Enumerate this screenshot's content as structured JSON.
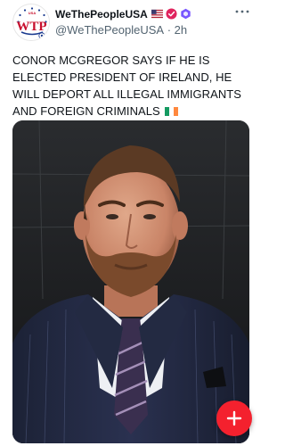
{
  "post": {
    "author": {
      "display_name": "WeThePeopleUSA",
      "handle": "@WeThePeopleUSA",
      "time": "2h",
      "avatar_text": "WTP",
      "avatar_subtext": "USA"
    },
    "text": "CONOR MCGREGOR SAYS IF HE IS ELECTED PRESIDENT OF IRELAND, HE WILL DEPORT ALL ILLEGAL IMMIGRANTS AND FOREIGN CRIMINALS",
    "text_flag": "ireland-flag",
    "badges": [
      "usa-flag",
      "verified-red-check",
      "purple-hexagon-badge"
    ],
    "media": {
      "description_icon": "photo"
    }
  },
  "ui": {
    "more_icon": "more-horizontal-icon",
    "compose_icon": "plus-icon"
  },
  "colors": {
    "accent": "#f4212e",
    "verified": "#e0245e",
    "hexagon": "#7856ff",
    "secondary_text": "#536471"
  }
}
